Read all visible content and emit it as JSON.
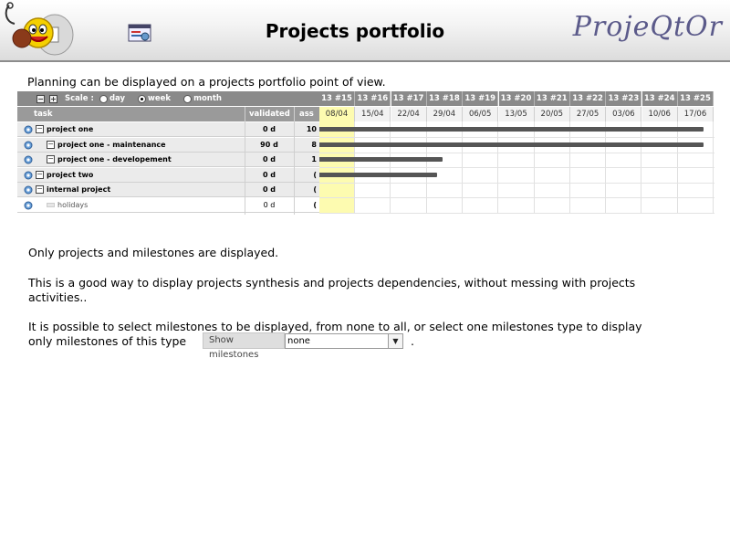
{
  "header": {
    "title": "Projects portfolio",
    "brand": "ProjeQtOr"
  },
  "intro": "Planning can be displayed on a projects portfolio point of view.",
  "gantt": {
    "scale_label": "Scale :",
    "scale_options": [
      "day",
      "week",
      "month"
    ],
    "scale_selected": "week",
    "columns": {
      "task": "task",
      "validated": "validated",
      "assigned": "ass"
    },
    "weeks": [
      "13 #15",
      "13 #16",
      "13 #17",
      "13 #18",
      "13 #19",
      "13 #20",
      "13 #21",
      "13 #22",
      "13 #23",
      "13 #24",
      "13 #25"
    ],
    "dates": [
      "08/04",
      "15/04",
      "22/04",
      "29/04",
      "06/05",
      "13/05",
      "20/05",
      "27/05",
      "03/06",
      "10/06",
      "17/06"
    ],
    "current_week": "08/04",
    "rows": [
      {
        "name": "project one",
        "validated": "0 d",
        "assigned": "10",
        "level": 0,
        "bold": true,
        "grey": true
      },
      {
        "name": "project one - maintenance",
        "validated": "90 d",
        "assigned": "8",
        "level": 1,
        "bold": true,
        "grey": true
      },
      {
        "name": "project one - developement",
        "validated": "0 d",
        "assigned": "1",
        "level": 1,
        "bold": true,
        "grey": true
      },
      {
        "name": "project two",
        "validated": "0 d",
        "assigned": "(",
        "level": 0,
        "bold": true,
        "grey": true
      },
      {
        "name": "internal project",
        "validated": "0 d",
        "assigned": "(",
        "level": 0,
        "bold": true,
        "grey": true
      },
      {
        "name": "holidays",
        "validated": "0 d",
        "assigned": "(",
        "level": 1,
        "bold": false,
        "grey": false
      }
    ],
    "colors": {
      "header": "#8a8a8a",
      "current_week": "#fdfbb0",
      "bar": "#555555"
    }
  },
  "paragraphs": {
    "p1": "Only projects and milestones are displayed.",
    "p2_line1": "This is a good way to display projects synthesis and projects dependencies, without messing with projects",
    "p2_line2": "activities..",
    "p3_line1": "It is possible to select milestones to be displayed, from none to all, or select one milestones type to display",
    "p3_line2": "only milestones of this type",
    "p3_end": "."
  },
  "milestones": {
    "label": "Show milestones",
    "value": "none"
  }
}
